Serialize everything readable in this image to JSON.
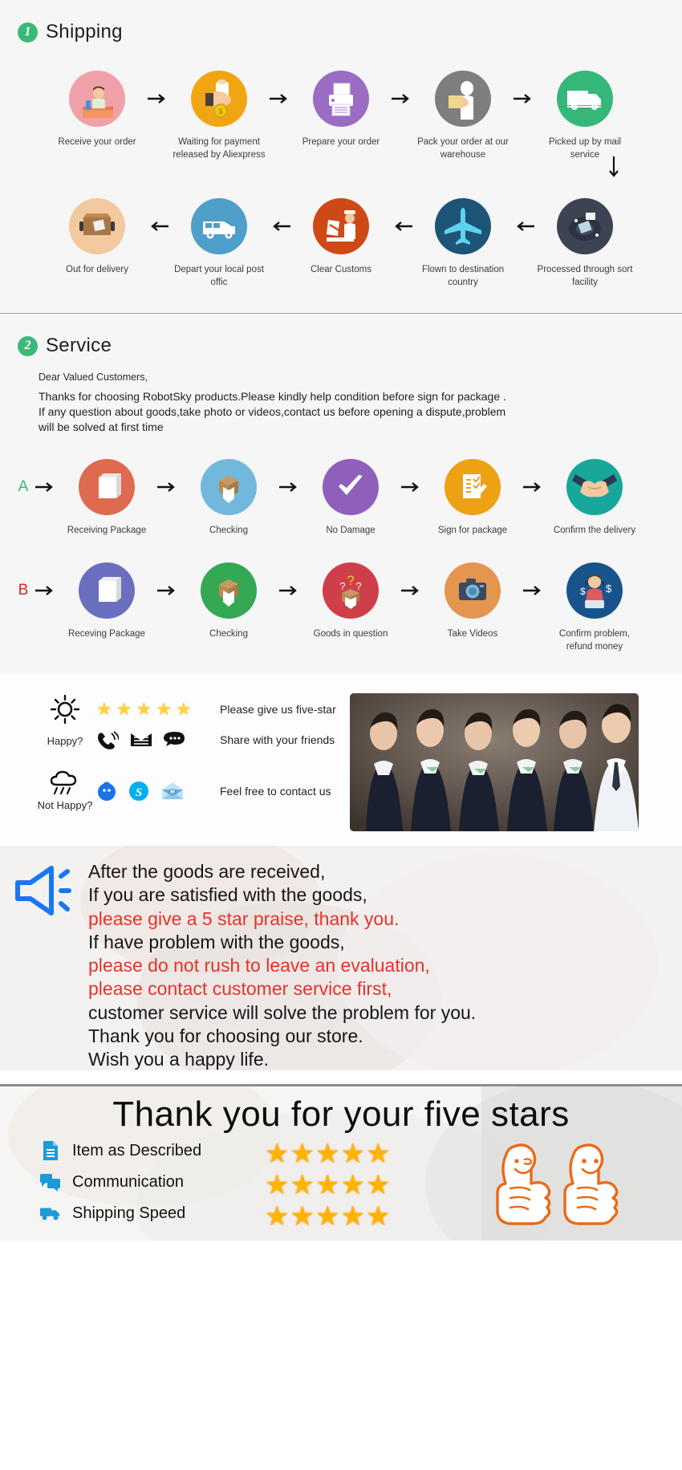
{
  "shipping": {
    "number": "1",
    "title": "Shipping",
    "row1": [
      {
        "label": "Receive your order",
        "icon": "person-at-desk-icon",
        "color": "#f0a0a8"
      },
      {
        "label": "Waiting for payment released by Aliexpress",
        "icon": "hand-holding-money-icon",
        "color": "#f2a513"
      },
      {
        "label": "Prepare your order",
        "icon": "printer-icon",
        "color": "#9b6cc4"
      },
      {
        "label": "Pack your order at our warehouse",
        "icon": "worker-packing-icon",
        "color": "#7e7e7e"
      },
      {
        "label": "Picked up by mail service",
        "icon": "delivery-truck-icon",
        "color": "#35b77a"
      }
    ],
    "row2": [
      {
        "label": "Out for delivery",
        "icon": "parcel-box-icon",
        "color": "#f3c9a0"
      },
      {
        "label": "Depart your local post offic",
        "icon": "delivery-van-icon",
        "color": "#4e9fc9"
      },
      {
        "label": "Clear  Customs",
        "icon": "customs-officer-icon",
        "color": "#cf4916"
      },
      {
        "label": "Flown to destination country",
        "icon": "airplane-icon",
        "color": "#1d5478"
      },
      {
        "label": "Processed through sort facility",
        "icon": "sorting-facility-icon",
        "color": "#3c4453"
      }
    ],
    "arrow_symbol": "→",
    "down_arrow_symbol": "↓",
    "left_arrow_symbol": "←"
  },
  "service": {
    "number": "2",
    "title": "Service",
    "greeting": "Dear Valued Customers,",
    "paragraph_lines": [
      "Thanks for choosing RobotSky products.Please kindly help condition before sign for package .",
      "If any question about goods,take photo or videos,contact us before opening a dispute,problem",
      "will be solved at first time"
    ],
    "row_a_letter": "A",
    "row_a": [
      {
        "label": "Receiving Package",
        "icon": "package-icon",
        "color": "#de6a4f"
      },
      {
        "label": "Checking",
        "icon": "open-box-icon",
        "color": "#72b8dd"
      },
      {
        "label": "No Damage",
        "icon": "checkmark-icon",
        "color": "#8e5fbb"
      },
      {
        "label": "Sign for package",
        "icon": "signed-document-icon",
        "color": "#eda114"
      },
      {
        "label": "Confirm the delivery",
        "icon": "handshake-icon",
        "color": "#17a79b"
      }
    ],
    "row_b_letter": "B",
    "row_b": [
      {
        "label": "Receving Package",
        "icon": "package-icon",
        "color": "#6b6fc0"
      },
      {
        "label": "Checking",
        "icon": "open-box-icon",
        "color": "#34a853"
      },
      {
        "label": "Goods in question",
        "icon": "question-box-icon",
        "color": "#cf3f49"
      },
      {
        "label": "Take Videos",
        "icon": "camera-icon",
        "color": "#e4954f"
      },
      {
        "label": "Confirm problem, refund money",
        "icon": "support-agent-money-icon",
        "color": "#17548c"
      }
    ]
  },
  "feedback": {
    "happy_label": "Happy?",
    "not_happy_label": "Not Happy?",
    "happy_icon": "sun-icon",
    "not_happy_icon": "rain-cloud-icon",
    "stars_count": 5,
    "star_symbol": "★",
    "five_star_text": "Please give us five-star",
    "share_text": "Share with your friends",
    "contact_text": "Feel free to contact us",
    "share_icons": [
      "phone-ringing-icon",
      "envelope-icon",
      "chat-bubble-icon"
    ],
    "contact_icons": [
      "qq-icon",
      "skype-icon",
      "email-open-icon"
    ],
    "photo_alt": "customer-service-team-photo"
  },
  "announcement": {
    "icon": "megaphone-icon",
    "lines": [
      {
        "text": "After the goods are received,",
        "color": "black"
      },
      {
        "text": "If you are satisfied with the goods,",
        "color": "black"
      },
      {
        "text": "please give a 5 star praise, thank you.",
        "color": "red"
      },
      {
        "text": "If have problem with the goods,",
        "color": "black"
      },
      {
        "text": "please do not rush to leave an evaluation,",
        "color": "red"
      },
      {
        "text": "please contact customer service first,",
        "color": "red"
      },
      {
        "text": "customer service will solve the problem for you.",
        "color": "black"
      },
      {
        "text": "Thank you for choosing our store.",
        "color": "black"
      },
      {
        "text": "Wish you a happy life.",
        "color": "black"
      }
    ],
    "red_color": "#e8312a",
    "black_color": "#161616"
  },
  "thanks": {
    "title": "Thank you for your five stars",
    "rows": [
      {
        "label": "Item as Described",
        "icon": "document-icon",
        "stars": 5
      },
      {
        "label": "Communication",
        "icon": "chat-icon",
        "stars": 5
      },
      {
        "label": "Shipping   Speed",
        "icon": "truck-icon",
        "stars": 5
      }
    ],
    "star_symbol": "★",
    "star_color": "#ffb400",
    "icon_color": "#1b9bd8",
    "thumbs_icon": "thumbs-up-smiley-icon",
    "thumbs_color": "#ea6a18"
  }
}
